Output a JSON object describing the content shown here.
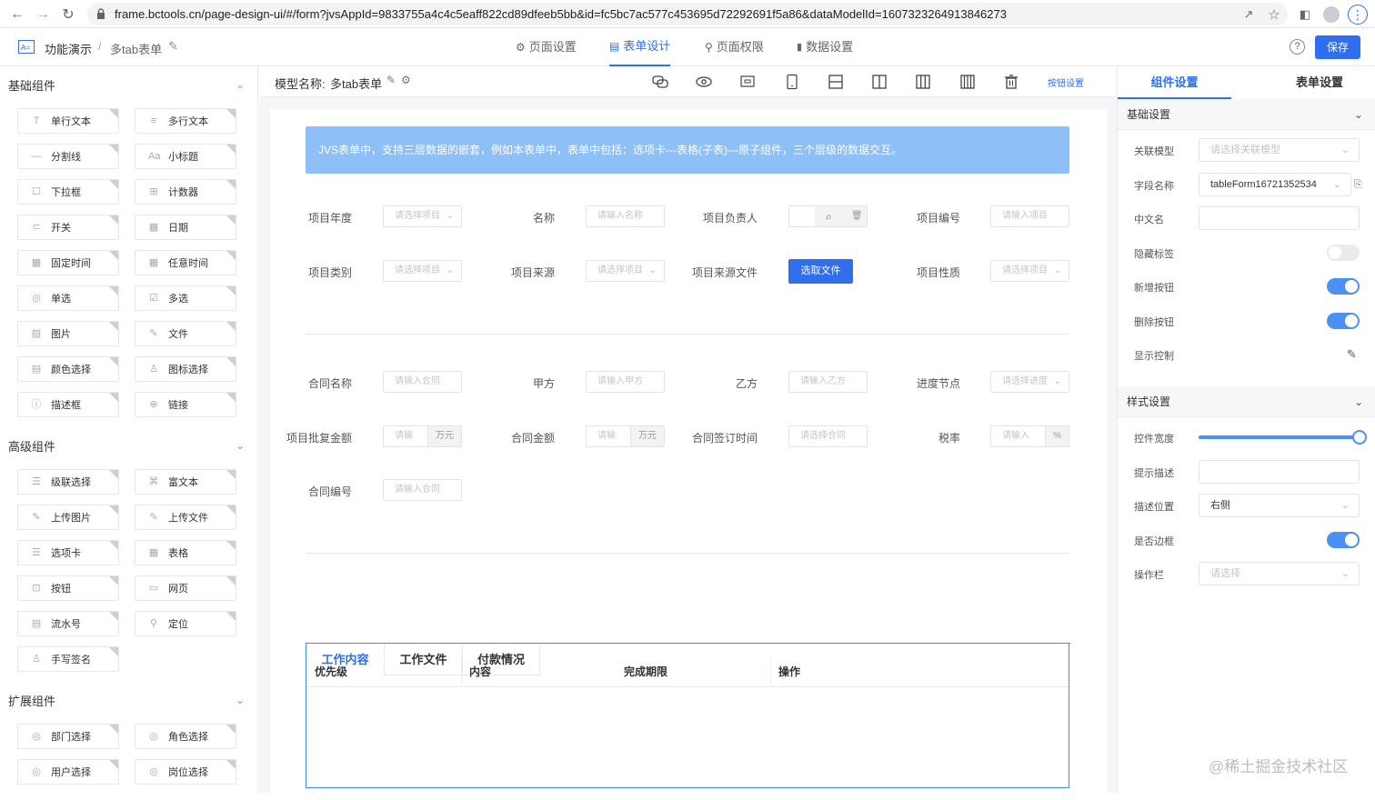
{
  "browser": {
    "url": "frame.bctools.cn/page-design-ui/#/form?jvsAppId=9833755a4c4c5eaff822cd89dfeeb5bb&id=fc5bc7ac577c453695d72292691f5a86&dataModelId=1607323264913846273"
  },
  "header": {
    "app_label": "功能演示",
    "form_name": "多tab表单",
    "tabs": [
      "页面设置",
      "表单设计",
      "页面权限",
      "数据设置"
    ],
    "save_label": "保存"
  },
  "left": {
    "basic_title": "基础组件",
    "basic_items": [
      "单行文本",
      "多行文本",
      "分割线",
      "小标题",
      "下拉框",
      "计数器",
      "开关",
      "日期",
      "固定时间",
      "任意时间",
      "单选",
      "多选",
      "图片",
      "文件",
      "颜色选择",
      "图标选择",
      "描述框",
      "链接"
    ],
    "advanced_title": "高级组件",
    "advanced_items": [
      "级联选择",
      "富文本",
      "上传图片",
      "上传文件",
      "选项卡",
      "表格",
      "按钮",
      "网页",
      "流水号",
      "定位",
      "手写签名"
    ],
    "ext_title": "扩展组件",
    "ext_items": [
      "部门选择",
      "角色选择",
      "用户选择",
      "岗位选择"
    ]
  },
  "toolbar": {
    "model_label": "模型名称:",
    "model_name": "多tab表单",
    "button_settings": "按钮设置"
  },
  "canvas": {
    "banner": "JVS表单中，支持三层数据的嵌套，例如本表单中，表单中包括：选项卡---表格(子表)---原子组件，三个层级的数据交互。",
    "row1": [
      {
        "label": "项目年度",
        "placeholder": "请选择项目"
      },
      {
        "label": "名称",
        "placeholder": "请输入名称"
      },
      {
        "label": "项目负责人",
        "placeholder": ""
      },
      {
        "label": "项目编号",
        "placeholder": "请输入项目"
      }
    ],
    "row2": [
      {
        "label": "项目类别",
        "placeholder": "请选择项目"
      },
      {
        "label": "项目来源",
        "placeholder": "请选择项目"
      },
      {
        "label": "项目来源文件",
        "button": "选取文件"
      },
      {
        "label": "项目性质",
        "placeholder": "请选择项目"
      }
    ],
    "row3": [
      {
        "label": "合同名称",
        "placeholder": "请输入合同"
      },
      {
        "label": "甲方",
        "placeholder": "请输入甲方"
      },
      {
        "label": "乙方",
        "placeholder": "请输入乙方"
      },
      {
        "label": "进度节点",
        "placeholder": "请选择进度"
      }
    ],
    "row4": [
      {
        "label": "项目批复金额",
        "placeholder": "请输",
        "suffix": "万元"
      },
      {
        "label": "合同金额",
        "placeholder": "请输",
        "suffix": "万元"
      },
      {
        "label": "合同签订时间",
        "placeholder": "请选择合同"
      },
      {
        "label": "税率",
        "placeholder": "请输入",
        "suffix": "%"
      }
    ],
    "row5": [
      {
        "label": "合同编号",
        "placeholder": "请输入合同"
      }
    ],
    "tabs": [
      "工作内容",
      "工作文件",
      "付款情况"
    ],
    "table_headers": [
      "优先级",
      "内容",
      "完成期限",
      "操作"
    ]
  },
  "right": {
    "tab_component": "组件设置",
    "tab_form": "表单设置",
    "basic_section": "基础设置",
    "fields": [
      {
        "label": "关联模型",
        "value": "请选择关联模型",
        "type": "select"
      },
      {
        "label": "字段名称",
        "value": "tableForm16721352534",
        "type": "select"
      },
      {
        "label": "中文名",
        "value": "",
        "type": "input"
      },
      {
        "label": "隐藏标签",
        "value": "off",
        "type": "toggle"
      },
      {
        "label": "新增按钮",
        "value": "on",
        "type": "toggle"
      },
      {
        "label": "删除按钮",
        "value": "on",
        "type": "toggle"
      },
      {
        "label": "显示控制",
        "value": "",
        "type": "edit"
      }
    ],
    "style_section": "样式设置",
    "style_fields": [
      {
        "label": "控件宽度",
        "value": 1.0,
        "type": "slider"
      },
      {
        "label": "提示描述",
        "value": "",
        "type": "input"
      },
      {
        "label": "描述位置",
        "value": "右侧",
        "type": "select"
      },
      {
        "label": "是否边框",
        "value": "on",
        "type": "toggle"
      },
      {
        "label": "操作栏",
        "value": "请选择",
        "type": "select"
      }
    ]
  },
  "watermark": "@稀土掘金技术社区",
  "colors": {
    "primary": "#2f6fed",
    "banner": "#8fbff7",
    "toggle_on": "#4a90f5",
    "toggle_off": "#ebebeb"
  }
}
